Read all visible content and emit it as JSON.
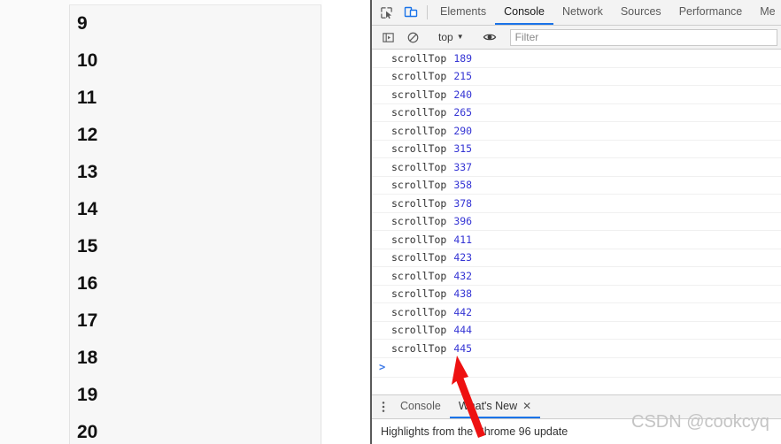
{
  "page": {
    "list_items": [
      "9",
      "10",
      "11",
      "12",
      "13",
      "14",
      "15",
      "16",
      "17",
      "18",
      "19",
      "20"
    ]
  },
  "devtools": {
    "toolbar_icons": [
      {
        "name": "inspect-element-icon"
      },
      {
        "name": "device-toolbar-icon"
      }
    ],
    "tabs": [
      {
        "label": "Elements",
        "active": false
      },
      {
        "label": "Console",
        "active": true
      },
      {
        "label": "Network",
        "active": false
      },
      {
        "label": "Sources",
        "active": false
      },
      {
        "label": "Performance",
        "active": false
      },
      {
        "label": "Me",
        "active": false
      }
    ],
    "filterbar": {
      "sidebar_toggle_icon": "show-console-sidebar-icon",
      "clear_icon": "clear-console-icon",
      "context": "top",
      "context_caret": "▼",
      "eye_icon": "create-live-expression-icon",
      "filter_placeholder": "Filter",
      "filter_value": ""
    },
    "console": {
      "messages": [
        {
          "label": "scrollTop",
          "value": "189"
        },
        {
          "label": "scrollTop",
          "value": "215"
        },
        {
          "label": "scrollTop",
          "value": "240"
        },
        {
          "label": "scrollTop",
          "value": "265"
        },
        {
          "label": "scrollTop",
          "value": "290"
        },
        {
          "label": "scrollTop",
          "value": "315"
        },
        {
          "label": "scrollTop",
          "value": "337"
        },
        {
          "label": "scrollTop",
          "value": "358"
        },
        {
          "label": "scrollTop",
          "value": "378"
        },
        {
          "label": "scrollTop",
          "value": "396"
        },
        {
          "label": "scrollTop",
          "value": "411"
        },
        {
          "label": "scrollTop",
          "value": "423"
        },
        {
          "label": "scrollTop",
          "value": "432"
        },
        {
          "label": "scrollTop",
          "value": "438"
        },
        {
          "label": "scrollTop",
          "value": "442"
        },
        {
          "label": "scrollTop",
          "value": "444"
        },
        {
          "label": "scrollTop",
          "value": "445"
        }
      ],
      "prompt_symbol": ">"
    },
    "drawer": {
      "menu_icon": "⋮",
      "tabs": [
        {
          "label": "Console",
          "active": false,
          "closable": false
        },
        {
          "label": "What's New",
          "active": true,
          "closable": true,
          "close_label": "✕"
        }
      ],
      "content_text": "Highlights from the Chrome 96 update"
    }
  },
  "annotation": {
    "arrow_color": "#ee1111"
  },
  "watermark": {
    "text": "CSDN @cookcyq"
  }
}
